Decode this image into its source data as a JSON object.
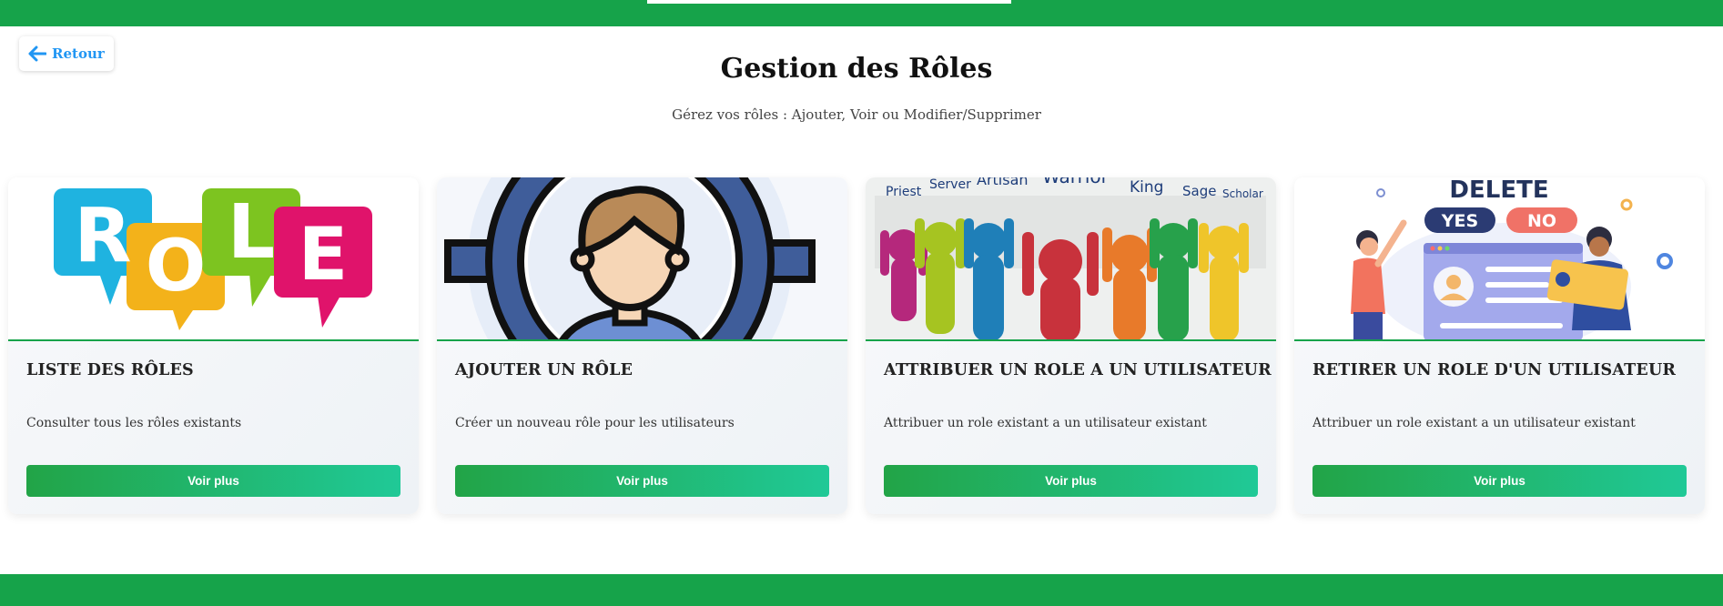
{
  "header": {
    "back_label": "Retour"
  },
  "page": {
    "title": "Gestion des Rôles",
    "subtitle": "Gérez vos rôles : Ajouter, Voir ou Modifier/Supprimer"
  },
  "cards": [
    {
      "title": "LISTE DES RÔLES",
      "description": "Consulter tous les rôles existants",
      "button": "Voir plus",
      "image": "role-speech-bubbles"
    },
    {
      "title": "AJOUTER UN RÔLE",
      "description": "Créer un nouveau rôle pour les utilisateurs",
      "button": "Voir plus",
      "image": "user-gear"
    },
    {
      "title": "ATTRIBUER UN ROLE A UN UTILISATEUR",
      "description": "Attribuer un role existant a un utilisateur existant",
      "button": "Voir plus",
      "image": "figures-with-role-labels"
    },
    {
      "title": "RETIRER UN ROLE D'UN UTILISATEUR",
      "description": "Attribuer un role existant a un utilisateur existant",
      "button": "Voir plus",
      "image": "delete-yes-no"
    }
  ],
  "illustrations": {
    "role_letters": [
      "R",
      "O",
      "L",
      "E"
    ],
    "role_words": [
      "Priest",
      "Server",
      "Artisan",
      "Warrior",
      "King",
      "Sage",
      "Scholar"
    ],
    "delete_title": "DELETE",
    "delete_yes": "YES",
    "delete_no": "NO"
  },
  "colors": {
    "brand": "#16a34a",
    "back": "#2196f3",
    "button_start": "#22a447",
    "button_end": "#20c997"
  }
}
